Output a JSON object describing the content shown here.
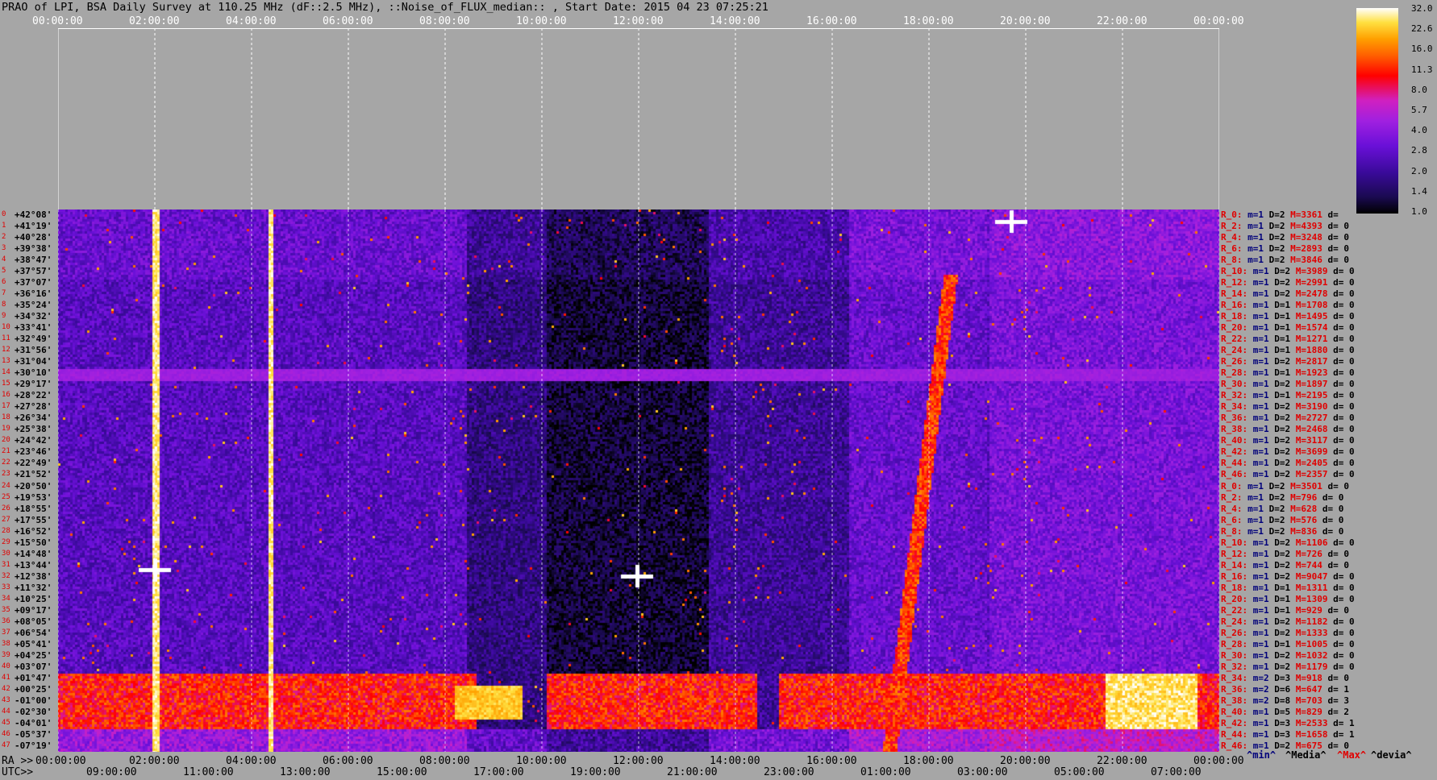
{
  "title": "PRAO of LPI, BSA Daily Survey at 110.25 MHz (dF::2.5 MHz), ::Noise_of_FLUX_median:: , Start Date: 2015 04 23 07:25:21",
  "top_ticks": [
    "00:00:00",
    "02:00:00",
    "04:00:00",
    "06:00:00",
    "08:00:00",
    "10:00:00",
    "12:00:00",
    "14:00:00",
    "16:00:00",
    "18:00:00",
    "20:00:00",
    "22:00:00",
    "00:00:00"
  ],
  "ra_prefix": "RA >>",
  "ra_ticks": [
    "00:00:00",
    "02:00:00",
    "04:00:00",
    "06:00:00",
    "08:00:00",
    "10:00:00",
    "12:00:00",
    "14:00:00",
    "16:00:00",
    "18:00:00",
    "20:00:00",
    "22:00:00",
    "00:00:00"
  ],
  "utc_prefix": "UTC>>",
  "utc_ticks": [
    "09:00:00",
    "11:00:00",
    "13:00:00",
    "15:00:00",
    "17:00:00",
    "19:00:00",
    "21:00:00",
    "23:00:00",
    "01:00:00",
    "03:00:00",
    "05:00:00",
    "07:00:00"
  ],
  "colorbar_labels": [
    "32.0",
    "22.6",
    "16.0",
    "11.3",
    "8.0",
    "5.7",
    "4.0",
    "2.8",
    "2.0",
    "1.4",
    "1.0"
  ],
  "legend": {
    "min": "^min^",
    "media": "^Media^",
    "max": "^Max^",
    "devia": "^devia^"
  },
  "colors": {
    "min": "#00007a",
    "media": "#000000",
    "max": "#e00000",
    "devia": "#000000"
  },
  "chart_data": {
    "type": "heatmap",
    "xlabel": "RA",
    "x_ticks": [
      "00:00:00",
      "02:00:00",
      "04:00:00",
      "06:00:00",
      "08:00:00",
      "10:00:00",
      "12:00:00",
      "14:00:00",
      "16:00:00",
      "18:00:00",
      "20:00:00",
      "22:00:00",
      "00:00:00"
    ],
    "y_ticks": [
      "+42°08'",
      "+41°19'",
      "+40°28'",
      "+39°38'",
      "+38°47'",
      "+37°57'",
      "+37°07'",
      "+36°16'",
      "+35°24'",
      "+34°32'",
      "+33°41'",
      "+32°49'",
      "+31°56'",
      "+31°04'",
      "+30°10'",
      "+29°17'",
      "+28°22'",
      "+27°28'",
      "+26°34'",
      "+25°38'",
      "+24°42'",
      "+23°46'",
      "+22°49'",
      "+21°52'",
      "+20°50'",
      "+19°53'",
      "+18°55'",
      "+17°55'",
      "+16°52'",
      "+15°50'",
      "+14°48'",
      "+13°44'",
      "+12°38'",
      "+11°32'",
      "+10°25'",
      "+09°17'",
      "+08°05'",
      "+06°54'",
      "+05°41'",
      "+04°25'",
      "+03°07'",
      "+01°47'",
      "+00°25'",
      "-01°00'",
      "-02°30'",
      "-04°01'",
      "-05°37'",
      "-07°19'"
    ],
    "colorscale": [
      "1.0",
      "1.4",
      "2.0",
      "2.8",
      "4.0",
      "5.7",
      "8.0",
      "11.3",
      "16.0",
      "22.6",
      "32.0"
    ],
    "row_stats": [
      {
        "r": "R_0:",
        "m": "m=1",
        "d": "D=2",
        "mx": "M=3361",
        "dv": "d="
      },
      {
        "r": "R_2:",
        "m": "m=1",
        "d": "D=2",
        "mx": "M=4393",
        "dv": "d= 0"
      },
      {
        "r": "R_4:",
        "m": "m=1",
        "d": "D=2",
        "mx": "M=3248",
        "dv": "d= 0"
      },
      {
        "r": "R_6:",
        "m": "m=1",
        "d": "D=2",
        "mx": "M=2893",
        "dv": "d= 0"
      },
      {
        "r": "R_8:",
        "m": "m=1",
        "d": "D=2",
        "mx": "M=3846",
        "dv": "d= 0"
      },
      {
        "r": "R_10:",
        "m": "m=1",
        "d": "D=2",
        "mx": "M=3989",
        "dv": "d= 0"
      },
      {
        "r": "R_12:",
        "m": "m=1",
        "d": "D=2",
        "mx": "M=2991",
        "dv": "d= 0"
      },
      {
        "r": "R_14:",
        "m": "m=1",
        "d": "D=2",
        "mx": "M=2478",
        "dv": "d= 0"
      },
      {
        "r": "R_16:",
        "m": "m=1",
        "d": "D=1",
        "mx": "M=1708",
        "dv": "d= 0"
      },
      {
        "r": "R_18:",
        "m": "m=1",
        "d": "D=1",
        "mx": "M=1495",
        "dv": "d= 0"
      },
      {
        "r": "R_20:",
        "m": "m=1",
        "d": "D=1",
        "mx": "M=1574",
        "dv": "d= 0"
      },
      {
        "r": "R_22:",
        "m": "m=1",
        "d": "D=1",
        "mx": "M=1271",
        "dv": "d= 0"
      },
      {
        "r": "R_24:",
        "m": "m=1",
        "d": "D=1",
        "mx": "M=1880",
        "dv": "d= 0"
      },
      {
        "r": "R_26:",
        "m": "m=1",
        "d": "D=2",
        "mx": "M=2817",
        "dv": "d= 0"
      },
      {
        "r": "R_28:",
        "m": "m=1",
        "d": "D=1",
        "mx": "M=1923",
        "dv": "d= 0"
      },
      {
        "r": "R_30:",
        "m": "m=1",
        "d": "D=2",
        "mx": "M=1897",
        "dv": "d= 0"
      },
      {
        "r": "R_32:",
        "m": "m=1",
        "d": "D=1",
        "mx": "M=2195",
        "dv": "d= 0"
      },
      {
        "r": "R_34:",
        "m": "m=1",
        "d": "D=2",
        "mx": "M=3190",
        "dv": "d= 0"
      },
      {
        "r": "R_36:",
        "m": "m=1",
        "d": "D=2",
        "mx": "M=2727",
        "dv": "d= 0"
      },
      {
        "r": "R_38:",
        "m": "m=1",
        "d": "D=2",
        "mx": "M=2468",
        "dv": "d= 0"
      },
      {
        "r": "R_40:",
        "m": "m=1",
        "d": "D=2",
        "mx": "M=3117",
        "dv": "d= 0"
      },
      {
        "r": "R_42:",
        "m": "m=1",
        "d": "D=2",
        "mx": "M=3699",
        "dv": "d= 0"
      },
      {
        "r": "R_44:",
        "m": "m=1",
        "d": "D=2",
        "mx": "M=2405",
        "dv": "d= 0"
      },
      {
        "r": "R_46:",
        "m": "m=1",
        "d": "D=2",
        "mx": "M=2357",
        "dv": "d= 0"
      },
      {
        "r": "R_0:",
        "m": "m=1",
        "d": "D=2",
        "mx": "M=3501",
        "dv": "d= 0"
      },
      {
        "r": "R_2:",
        "m": "m=1",
        "d": "D=2",
        "mx": "M=796",
        "dv": "d= 0"
      },
      {
        "r": "R_4:",
        "m": "m=1",
        "d": "D=2",
        "mx": "M=628",
        "dv": "d= 0"
      },
      {
        "r": "R_6:",
        "m": "m=1",
        "d": "D=2",
        "mx": "M=576",
        "dv": "d= 0"
      },
      {
        "r": "R_8:",
        "m": "m=1",
        "d": "D=2",
        "mx": "M=836",
        "dv": "d= 0"
      },
      {
        "r": "R_10:",
        "m": "m=1",
        "d": "D=2",
        "mx": "M=1106",
        "dv": "d= 0"
      },
      {
        "r": "R_12:",
        "m": "m=1",
        "d": "D=2",
        "mx": "M=726",
        "dv": "d= 0"
      },
      {
        "r": "R_14:",
        "m": "m=1",
        "d": "D=2",
        "mx": "M=744",
        "dv": "d= 0"
      },
      {
        "r": "R_16:",
        "m": "m=1",
        "d": "D=2",
        "mx": "M=9047",
        "dv": "d= 0"
      },
      {
        "r": "R_18:",
        "m": "m=1",
        "d": "D=1",
        "mx": "M=1311",
        "dv": "d= 0"
      },
      {
        "r": "R_20:",
        "m": "m=1",
        "d": "D=1",
        "mx": "M=1309",
        "dv": "d= 0"
      },
      {
        "r": "R_22:",
        "m": "m=1",
        "d": "D=1",
        "mx": "M=929",
        "dv": "d= 0"
      },
      {
        "r": "R_24:",
        "m": "m=1",
        "d": "D=2",
        "mx": "M=1182",
        "dv": "d= 0"
      },
      {
        "r": "R_26:",
        "m": "m=1",
        "d": "D=2",
        "mx": "M=1333",
        "dv": "d= 0"
      },
      {
        "r": "R_28:",
        "m": "m=1",
        "d": "D=1",
        "mx": "M=1005",
        "dv": "d= 0"
      },
      {
        "r": "R_30:",
        "m": "m=1",
        "d": "D=2",
        "mx": "M=1032",
        "dv": "d= 0"
      },
      {
        "r": "R_32:",
        "m": "m=1",
        "d": "D=2",
        "mx": "M=1179",
        "dv": "d= 0"
      },
      {
        "r": "R_34:",
        "m": "m=2",
        "d": "D=3",
        "mx": "M=918",
        "dv": "d= 0"
      },
      {
        "r": "R_36:",
        "m": "m=2",
        "d": "D=6",
        "mx": "M=647",
        "dv": "d= 1"
      },
      {
        "r": "R_38:",
        "m": "m=2",
        "d": "D=8",
        "mx": "M=703",
        "dv": "d= 3"
      },
      {
        "r": "R_40:",
        "m": "m=1",
        "d": "D=5",
        "mx": "M=829",
        "dv": "d= 2"
      },
      {
        "r": "R_42:",
        "m": "m=1",
        "d": "D=3",
        "mx": "M=2533",
        "dv": "d= 1"
      },
      {
        "r": "R_44:",
        "m": "m=1",
        "d": "D=3",
        "mx": "M=1658",
        "dv": "d= 1"
      },
      {
        "r": "R_46:",
        "m": "m=1",
        "d": "D=2",
        "mx": "M=675",
        "dv": "d= 0"
      }
    ]
  }
}
